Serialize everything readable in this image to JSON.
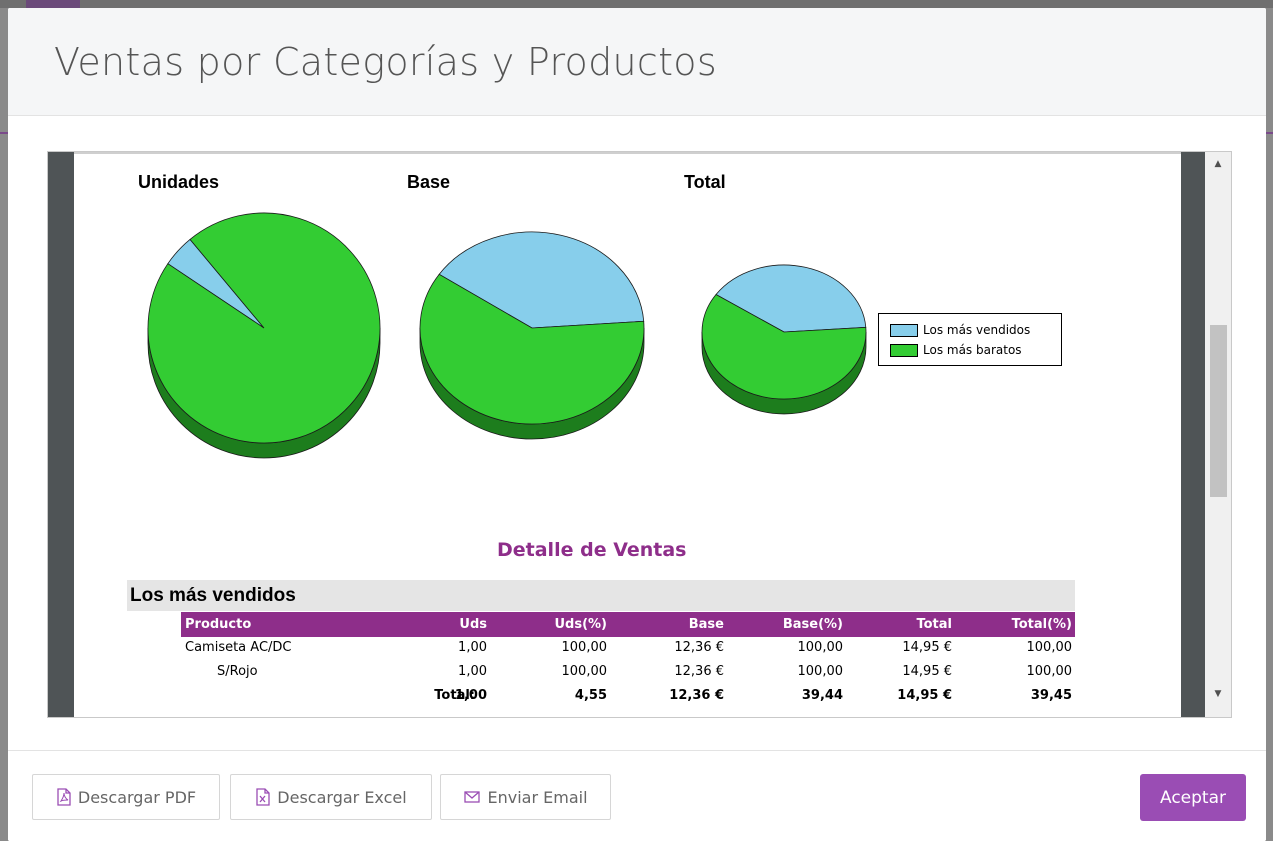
{
  "modal": {
    "title": "Ventas por Categorías y Productos"
  },
  "report": {
    "charts": {
      "titles": [
        "Unidades",
        "Base",
        "Total"
      ],
      "legend": [
        {
          "label": "Los más vendidos",
          "color": "#87ceeb"
        },
        {
          "label": "Los más baratos",
          "color": "#33cc33"
        }
      ]
    },
    "section_title": "Detalle de Ventas",
    "group_label": "Los más vendidos",
    "table": {
      "headers": [
        "Producto",
        "Uds",
        "Uds(%)",
        "Base",
        "Base(%)",
        "Total",
        "Total(%)"
      ],
      "rows": [
        [
          "Camiseta AC/DC",
          "1,00",
          "100,00",
          "12,36 €",
          "100,00",
          "14,95 €",
          "100,00"
        ],
        [
          "S/Rojo",
          "1,00",
          "100,00",
          "12,36 €",
          "100,00",
          "14,95 €",
          "100,00"
        ]
      ],
      "total_row": [
        "Total:",
        "1,00",
        "4,55",
        "12,36 €",
        "39,44",
        "14,95 €",
        "39,45"
      ]
    }
  },
  "chart_data": [
    {
      "type": "pie",
      "title": "Unidades",
      "labels": [
        "Los más vendidos",
        "Los más baratos"
      ],
      "values": [
        4.55,
        95.45
      ],
      "colors": [
        "#87ceeb",
        "#33cc33"
      ]
    },
    {
      "type": "pie",
      "title": "Base",
      "labels": [
        "Los más vendidos",
        "Los más baratos"
      ],
      "values": [
        39.44,
        60.56
      ],
      "colors": [
        "#87ceeb",
        "#33cc33"
      ]
    },
    {
      "type": "pie",
      "title": "Total",
      "labels": [
        "Los más vendidos",
        "Los más baratos"
      ],
      "values": [
        39.45,
        60.55
      ],
      "colors": [
        "#87ceeb",
        "#33cc33"
      ]
    }
  ],
  "footer": {
    "pdf_label": "Descargar PDF",
    "excel_label": "Descargar Excel",
    "email_label": "Enviar Email",
    "accept_label": "Aceptar"
  },
  "icons": {
    "pdf": "file-pdf-icon",
    "excel": "file-excel-icon",
    "email": "envelope-icon",
    "scroll_up": "triangle-up-icon",
    "scroll_down": "triangle-down-icon"
  },
  "colors": {
    "accent": "#8e2e8a",
    "primary_button": "#9a4db4",
    "pie_blue": "#87ceeb",
    "pie_green": "#33cc33"
  }
}
